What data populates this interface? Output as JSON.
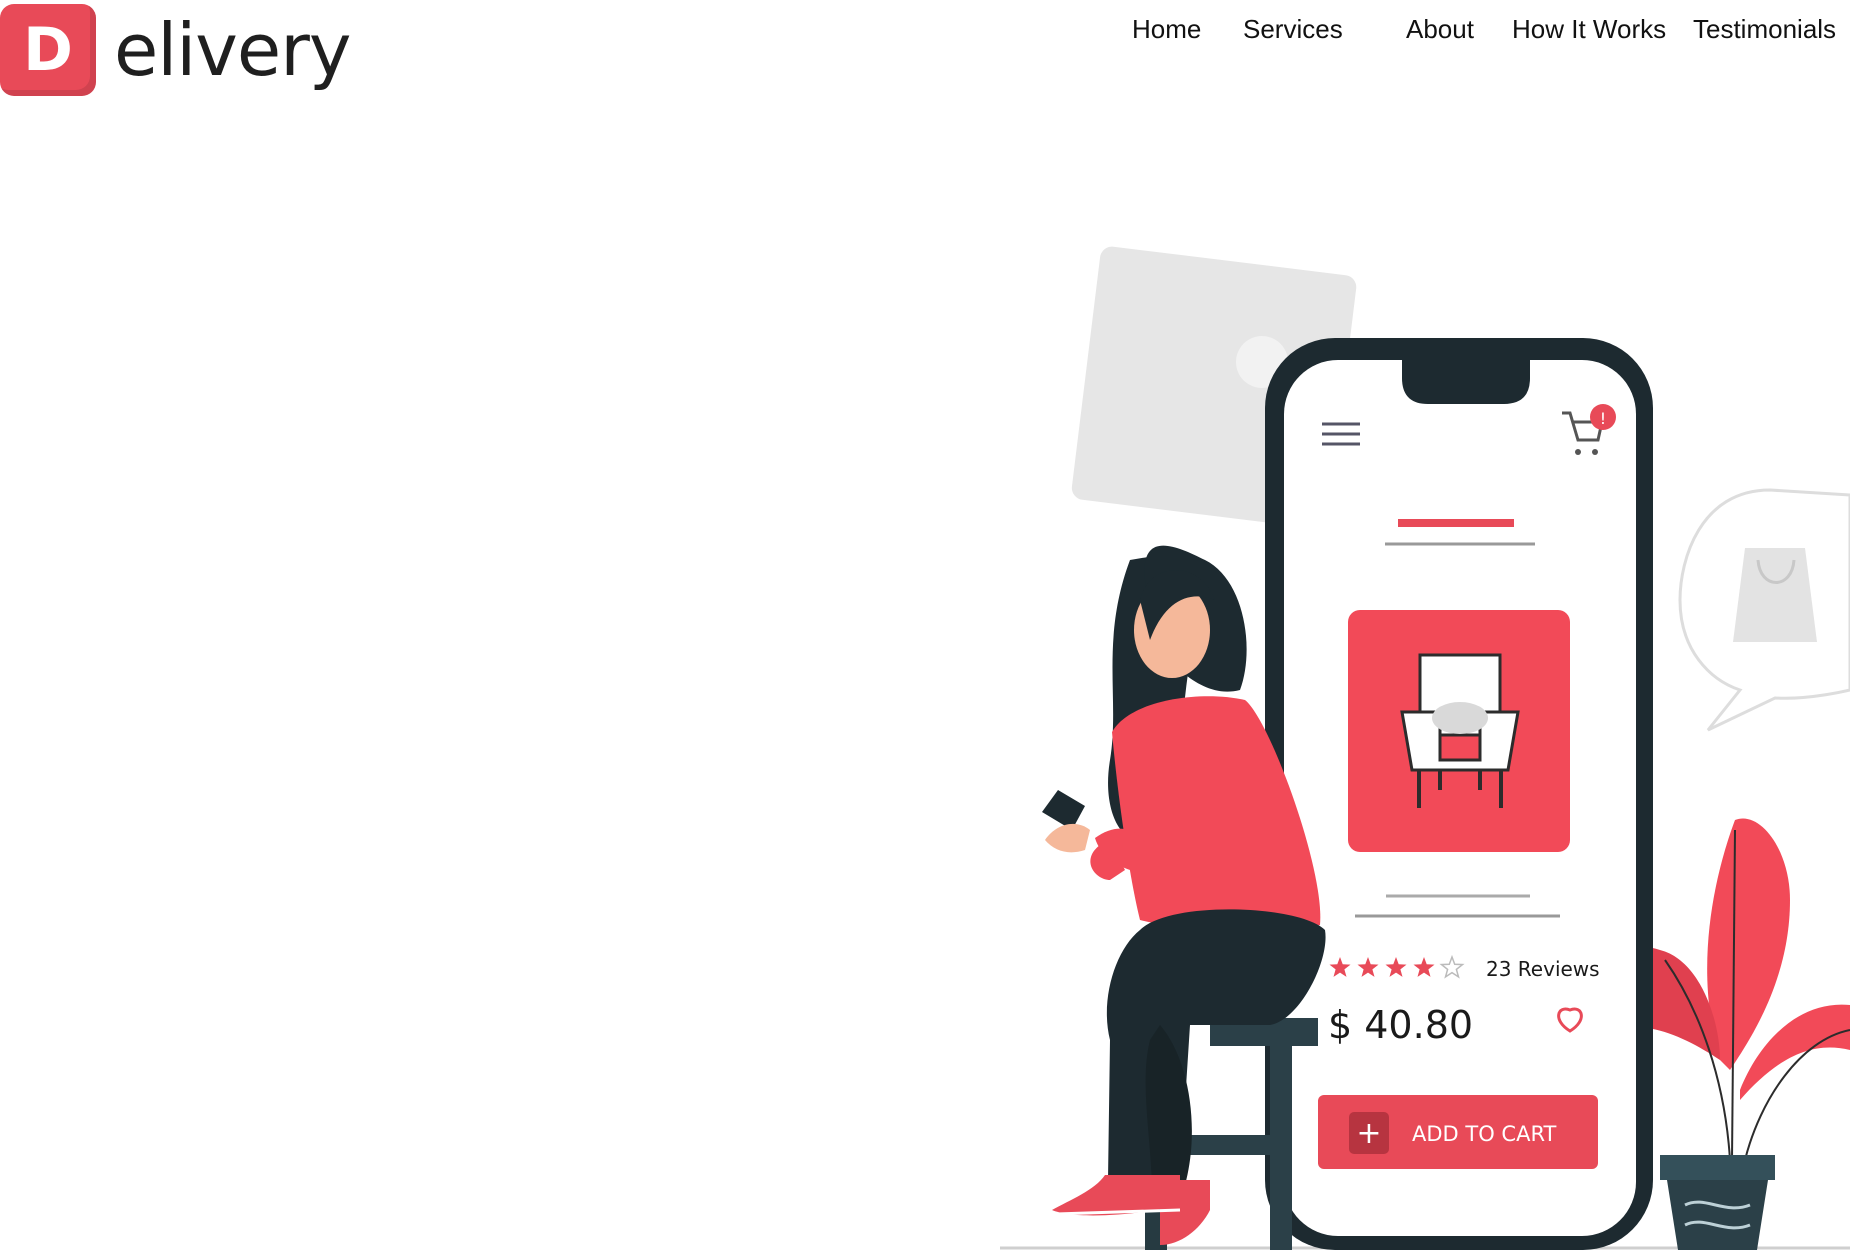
{
  "brand": {
    "logo_letter": "D",
    "name": "elivery"
  },
  "nav": {
    "home": "Home",
    "services": "Services",
    "about": "About",
    "how_it_works": "How It Works",
    "testimonials": "Testimonials"
  },
  "phone": {
    "cart_badge": "!",
    "rating": {
      "stars_filled": 4,
      "stars_total": 5,
      "reviews_label": "23 Reviews"
    },
    "price": "$ 40.80",
    "add_to_cart_plus": "+",
    "add_to_cart_label": "ADD TO CART"
  },
  "colors": {
    "accent": "#e84a58",
    "dark": "#1d2a30",
    "light_gray": "#e6e6e6"
  },
  "icons": [
    "hamburger-menu-icon",
    "shopping-cart-icon",
    "star-icon",
    "heart-icon",
    "plus-icon",
    "armchair-icon",
    "shopping-bag-icon"
  ]
}
